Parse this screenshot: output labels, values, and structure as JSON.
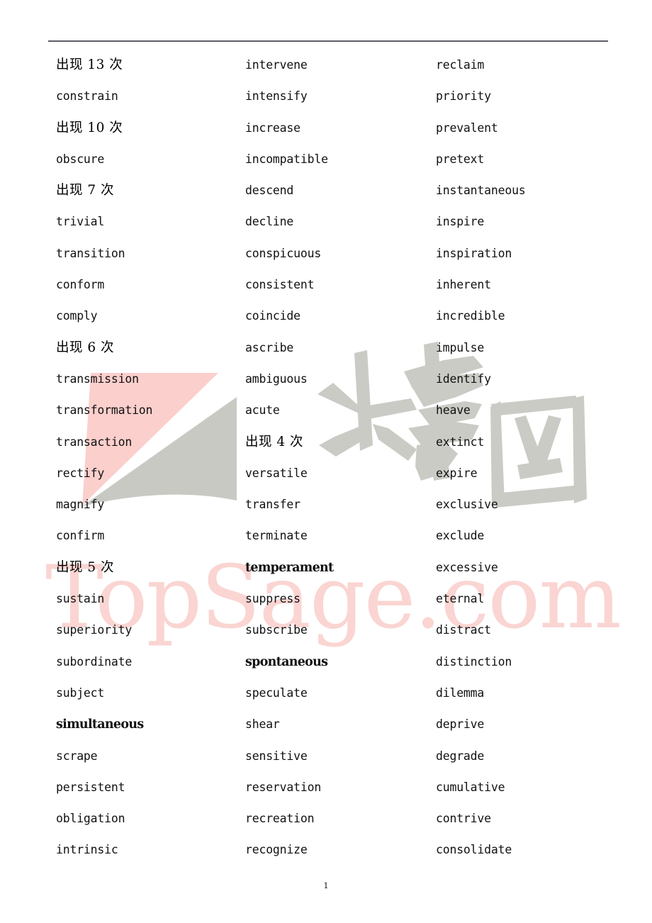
{
  "document": {
    "page_number": "1",
    "horizontal_rule": true
  },
  "watermarks": {
    "brand_text": "TopSage.com",
    "brand_color": "#fad5d2",
    "cjk_text": "大家网",
    "cjk_color": "#c9cac4",
    "logo_pink_color": "#fbcfcc",
    "logo_grey_color": "#c9c9c4"
  },
  "columns": [
    {
      "name": "column-1",
      "entries": [
        {
          "text": "出现 13 次",
          "style": "heading"
        },
        {
          "text": "constrain",
          "style": "normal"
        },
        {
          "text": "出现 10 次",
          "style": "heading"
        },
        {
          "text": "obscure",
          "style": "normal"
        },
        {
          "text": "出现 7 次",
          "style": "heading"
        },
        {
          "text": "trivial",
          "style": "normal"
        },
        {
          "text": "transition",
          "style": "normal"
        },
        {
          "text": "conform",
          "style": "normal"
        },
        {
          "text": "comply",
          "style": "normal"
        },
        {
          "text": "出现 6 次",
          "style": "heading"
        },
        {
          "text": "transmission",
          "style": "normal"
        },
        {
          "text": "transformation",
          "style": "normal"
        },
        {
          "text": "transaction",
          "style": "normal"
        },
        {
          "text": "rectify",
          "style": "normal"
        },
        {
          "text": "magnify",
          "style": "normal"
        },
        {
          "text": "confirm",
          "style": "normal"
        },
        {
          "text": "出现 5 次",
          "style": "heading"
        },
        {
          "text": "sustain",
          "style": "normal"
        },
        {
          "text": "superiority",
          "style": "normal"
        },
        {
          "text": "subordinate",
          "style": "normal"
        },
        {
          "text": "subject",
          "style": "normal"
        },
        {
          "text": "simultaneous",
          "style": "bold"
        },
        {
          "text": "scrape",
          "style": "normal"
        },
        {
          "text": "persistent",
          "style": "normal"
        },
        {
          "text": "obligation",
          "style": "normal"
        },
        {
          "text": "intrinsic",
          "style": "normal"
        }
      ]
    },
    {
      "name": "column-2",
      "entries": [
        {
          "text": "intervene",
          "style": "normal"
        },
        {
          "text": "intensify",
          "style": "normal"
        },
        {
          "text": "increase",
          "style": "normal"
        },
        {
          "text": "incompatible",
          "style": "normal"
        },
        {
          "text": "descend",
          "style": "normal"
        },
        {
          "text": "decline",
          "style": "normal"
        },
        {
          "text": "conspicuous",
          "style": "normal"
        },
        {
          "text": "consistent",
          "style": "normal"
        },
        {
          "text": "coincide",
          "style": "normal"
        },
        {
          "text": "ascribe",
          "style": "normal"
        },
        {
          "text": "ambiguous",
          "style": "normal"
        },
        {
          "text": "acute",
          "style": "normal"
        },
        {
          "text": "出现 4 次",
          "style": "heading"
        },
        {
          "text": "versatile",
          "style": "normal"
        },
        {
          "text": "transfer",
          "style": "normal"
        },
        {
          "text": "terminate",
          "style": "normal"
        },
        {
          "text": "temperament",
          "style": "bold"
        },
        {
          "text": "suppress",
          "style": "normal"
        },
        {
          "text": "subscribe",
          "style": "normal"
        },
        {
          "text": "spontaneous",
          "style": "bold"
        },
        {
          "text": "speculate",
          "style": "normal"
        },
        {
          "text": "shear",
          "style": "normal"
        },
        {
          "text": "sensitive",
          "style": "normal"
        },
        {
          "text": "reservation",
          "style": "normal"
        },
        {
          "text": "recreation",
          "style": "normal"
        },
        {
          "text": "recognize",
          "style": "normal"
        }
      ]
    },
    {
      "name": "column-3",
      "entries": [
        {
          "text": "reclaim",
          "style": "normal"
        },
        {
          "text": "priority",
          "style": "normal"
        },
        {
          "text": "prevalent",
          "style": "normal"
        },
        {
          "text": "pretext",
          "style": "normal"
        },
        {
          "text": "instantaneous",
          "style": "normal"
        },
        {
          "text": "inspire",
          "style": "normal"
        },
        {
          "text": "inspiration",
          "style": "normal"
        },
        {
          "text": "inherent",
          "style": "normal"
        },
        {
          "text": "incredible",
          "style": "normal"
        },
        {
          "text": "impulse",
          "style": "normal"
        },
        {
          "text": "identify",
          "style": "normal"
        },
        {
          "text": "heave",
          "style": "normal"
        },
        {
          "text": "extinct",
          "style": "normal"
        },
        {
          "text": "expire",
          "style": "normal"
        },
        {
          "text": "exclusive",
          "style": "normal"
        },
        {
          "text": "exclude",
          "style": "normal"
        },
        {
          "text": "excessive",
          "style": "normal"
        },
        {
          "text": "eternal",
          "style": "normal"
        },
        {
          "text": "distract",
          "style": "normal"
        },
        {
          "text": "distinction",
          "style": "normal"
        },
        {
          "text": "dilemma",
          "style": "normal"
        },
        {
          "text": "deprive",
          "style": "normal"
        },
        {
          "text": "degrade",
          "style": "normal"
        },
        {
          "text": "cumulative",
          "style": "normal"
        },
        {
          "text": "contrive",
          "style": "normal"
        },
        {
          "text": "consolidate",
          "style": "normal"
        }
      ]
    }
  ]
}
